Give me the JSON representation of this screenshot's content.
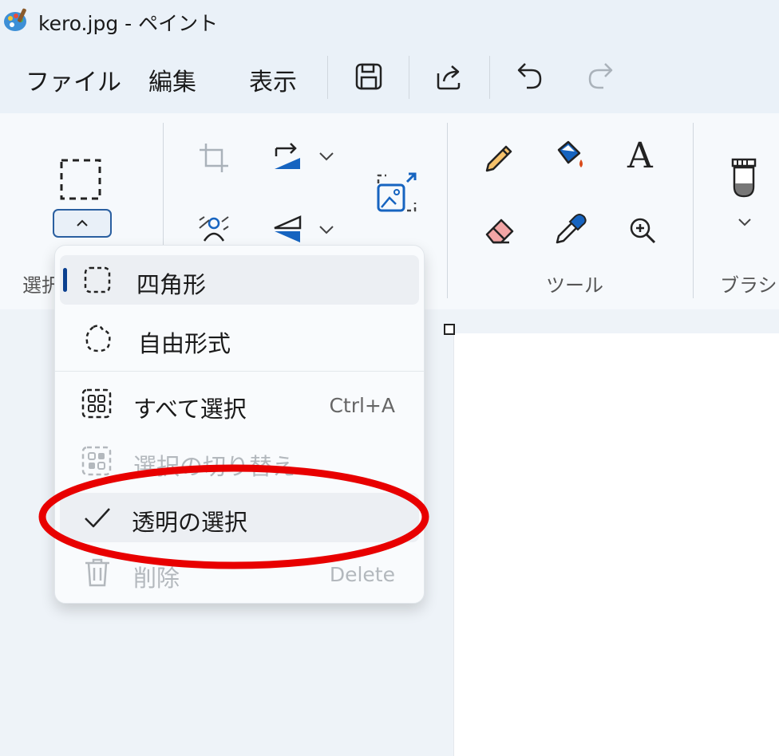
{
  "window": {
    "title": "kero.jpg - ペイント"
  },
  "menubar": {
    "items": [
      "ファイル",
      "編集",
      "表示"
    ],
    "toolbar_icons": [
      "save-icon",
      "share-icon",
      "undo-icon",
      "redo-icon"
    ]
  },
  "ribbon": {
    "groups": {
      "selection_label": "選択",
      "tools_label": "ツール",
      "brushes_label": "ブラシ"
    }
  },
  "dropdown": {
    "items": [
      {
        "label": "四角形",
        "shortcut": "",
        "enabled": true,
        "selected": true
      },
      {
        "label": "自由形式",
        "shortcut": "",
        "enabled": true,
        "selected": false
      },
      {
        "label": "すべて選択",
        "shortcut": "Ctrl+A",
        "enabled": true,
        "selected": false
      },
      {
        "label": "選択の切り替え",
        "shortcut": "",
        "enabled": false,
        "selected": false
      },
      {
        "label": "透明の選択",
        "shortcut": "",
        "enabled": true,
        "checked": true
      },
      {
        "label": "削除",
        "shortcut": "Delete",
        "enabled": false,
        "selected": false
      }
    ]
  },
  "colors": {
    "accent": "#0a3f8f",
    "highlight_annotation": "#e80000"
  }
}
